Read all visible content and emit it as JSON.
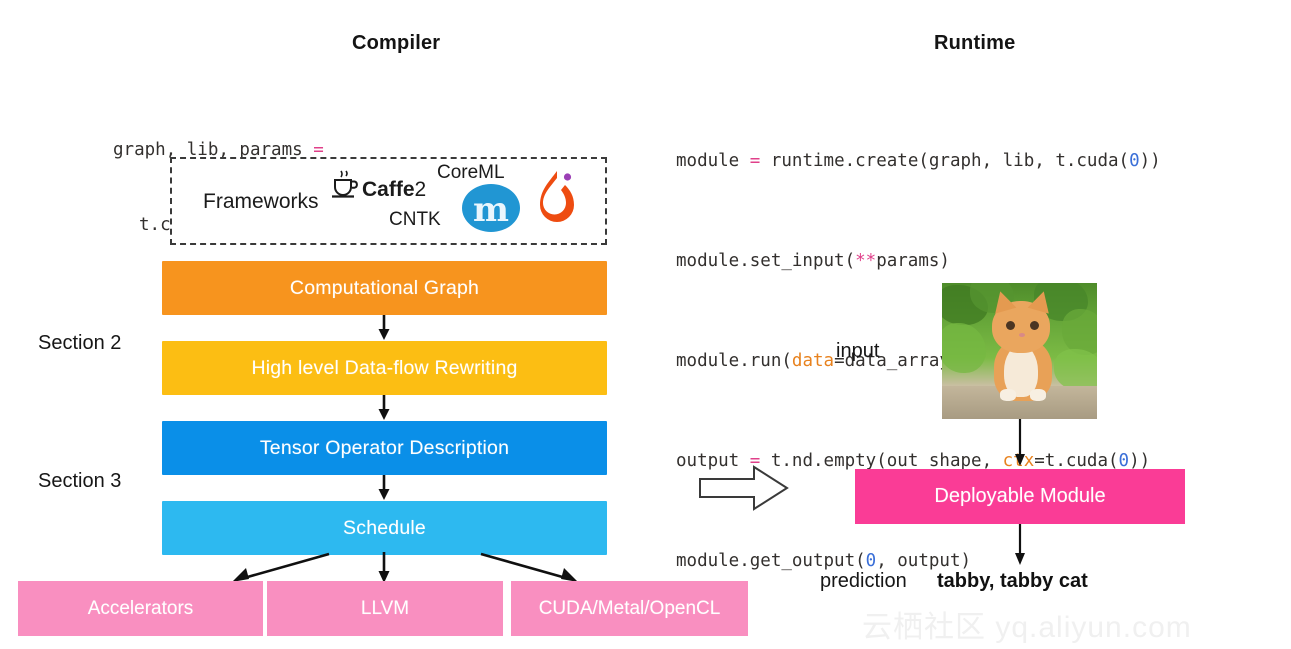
{
  "headings": {
    "compiler": "Compiler",
    "runtime": "Runtime"
  },
  "compiler_code": {
    "line1_a": "graph, lib, params ",
    "line1_op": "=",
    "line2": "t.compiler.build(graph, target, params)"
  },
  "runtime_code": {
    "l1_a": "module ",
    "l1_op": "=",
    "l1_b": " runtime.create(graph, lib, t.cuda(",
    "l1_n": "0",
    "l1_c": "))",
    "l2_a": "module.set_input(",
    "l2_op": "**",
    "l2_b": "params)",
    "l3_a": "module.run(",
    "l3_kw": "data",
    "l3_b": "=data_array)",
    "l4_a": "output ",
    "l4_op": "=",
    "l4_b": " t.nd.empty(out_shape, ",
    "l4_kw": "ctx",
    "l4_c": "=t.cuda(",
    "l4_n": "0",
    "l4_d": "))",
    "l5_a": "module.get_output(",
    "l5_n": "0",
    "l5_b": ", output)"
  },
  "frameworks": {
    "label": "Frameworks",
    "caffe_bold": "Caffe",
    "caffe_thin": "2",
    "coreml": "CoreML",
    "cntk": "CNTK"
  },
  "sections": {
    "section2": "Section 2",
    "section3": "Section 3"
  },
  "stack": [
    {
      "label": "Computational Graph",
      "color": "#f7941e"
    },
    {
      "label": "High level Data-flow Rewriting",
      "color": "#fcbe13"
    },
    {
      "label": "Tensor Operator Description",
      "color": "#0a8fe8"
    },
    {
      "label": "Schedule",
      "color": "#2db9f0"
    }
  ],
  "backends": [
    {
      "label": "Accelerators",
      "color": "#f98fc0"
    },
    {
      "label": "LLVM",
      "color": "#f98fc0"
    },
    {
      "label": "CUDA/Metal/OpenCL",
      "color": "#f98fc0"
    }
  ],
  "runtime_panel": {
    "input_label": "input",
    "deployable_module": "Deployable Module",
    "deployable_color": "#fa3c96",
    "prediction_label": "prediction",
    "prediction_value": "tabby, tabby cat"
  },
  "watermark": {
    "text": "云栖社区 yq.aliyun.com"
  }
}
